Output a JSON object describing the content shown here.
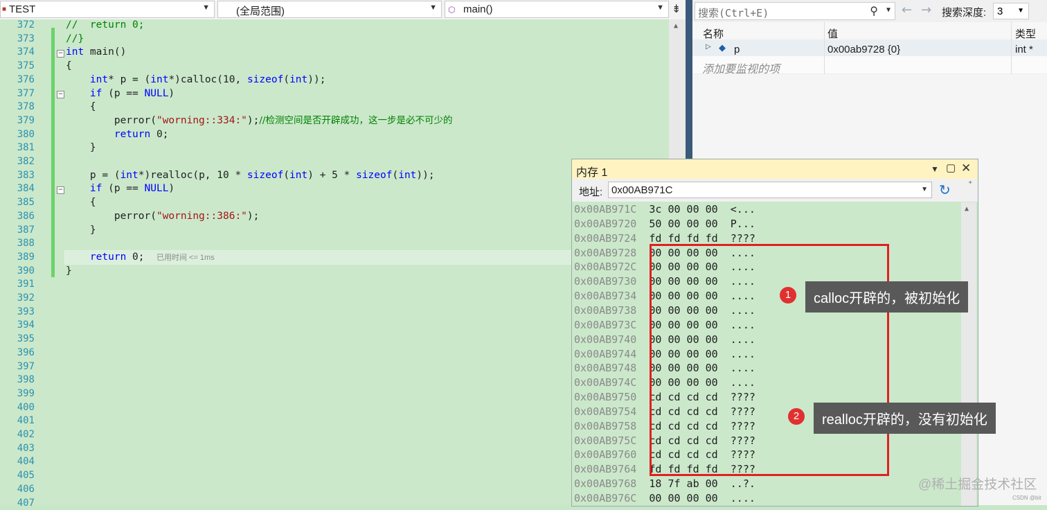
{
  "topbar": {
    "project": "TEST",
    "scope": "(全局范围)",
    "function": "main()"
  },
  "editor": {
    "line_numbers": [
      "372",
      "373",
      "374",
      "375",
      "376",
      "377",
      "378",
      "379",
      "380",
      "381",
      "382",
      "383",
      "384",
      "385",
      "386",
      "387",
      "388",
      "389",
      "390",
      "391",
      "392",
      "393",
      "394",
      "395",
      "396",
      "397",
      "398",
      "399",
      "400",
      "401",
      "402",
      "403",
      "404",
      "405",
      "406",
      "407"
    ],
    "elapsed_hint": "已用时间 <= 1ms"
  },
  "watch": {
    "search_placeholder": "搜索(Ctrl+E)",
    "depth_label": "搜索深度:",
    "depth_value": "3",
    "columns": {
      "name": "名称",
      "value": "值",
      "type": "类型"
    },
    "rows": [
      {
        "name": "p",
        "value": "0x00ab9728 {0}",
        "type": "int *"
      }
    ],
    "add_watch": "添加要监视的项"
  },
  "memory": {
    "title": "内存 1",
    "address_label": "地址:",
    "address_value": "0x00AB971C",
    "rows": [
      {
        "addr": "0x00AB971C",
        "bytes": "3c 00 00 00",
        "chars": "<..."
      },
      {
        "addr": "0x00AB9720",
        "bytes": "50 00 00 00",
        "chars": "P..."
      },
      {
        "addr": "0x00AB9724",
        "bytes": "fd fd fd fd",
        "chars": "????"
      },
      {
        "addr": "0x00AB9728",
        "bytes": "00 00 00 00",
        "chars": "...."
      },
      {
        "addr": "0x00AB972C",
        "bytes": "00 00 00 00",
        "chars": "...."
      },
      {
        "addr": "0x00AB9730",
        "bytes": "00 00 00 00",
        "chars": "...."
      },
      {
        "addr": "0x00AB9734",
        "bytes": "00 00 00 00",
        "chars": "...."
      },
      {
        "addr": "0x00AB9738",
        "bytes": "00 00 00 00",
        "chars": "...."
      },
      {
        "addr": "0x00AB973C",
        "bytes": "00 00 00 00",
        "chars": "...."
      },
      {
        "addr": "0x00AB9740",
        "bytes": "00 00 00 00",
        "chars": "...."
      },
      {
        "addr": "0x00AB9744",
        "bytes": "00 00 00 00",
        "chars": "...."
      },
      {
        "addr": "0x00AB9748",
        "bytes": "00 00 00 00",
        "chars": "...."
      },
      {
        "addr": "0x00AB974C",
        "bytes": "00 00 00 00",
        "chars": "...."
      },
      {
        "addr": "0x00AB9750",
        "bytes": "cd cd cd cd",
        "chars": "????"
      },
      {
        "addr": "0x00AB9754",
        "bytes": "cd cd cd cd",
        "chars": "????"
      },
      {
        "addr": "0x00AB9758",
        "bytes": "cd cd cd cd",
        "chars": "????"
      },
      {
        "addr": "0x00AB975C",
        "bytes": "cd cd cd cd",
        "chars": "????"
      },
      {
        "addr": "0x00AB9760",
        "bytes": "cd cd cd cd",
        "chars": "????"
      },
      {
        "addr": "0x00AB9764",
        "bytes": "fd fd fd fd",
        "chars": "????"
      },
      {
        "addr": "0x00AB9768",
        "bytes": "18 7f ab 00",
        "chars": "..?."
      },
      {
        "addr": "0x00AB976C",
        "bytes": "00 00 00 00",
        "chars": "...."
      }
    ]
  },
  "annotations": {
    "badge1": "1",
    "callout1": "calloc开辟的，被初始化",
    "badge2": "2",
    "callout2": "realloc开辟的，没有初始化"
  },
  "watermark": "@稀土掘金技术社区",
  "watermark_small": "CSDN @bit"
}
